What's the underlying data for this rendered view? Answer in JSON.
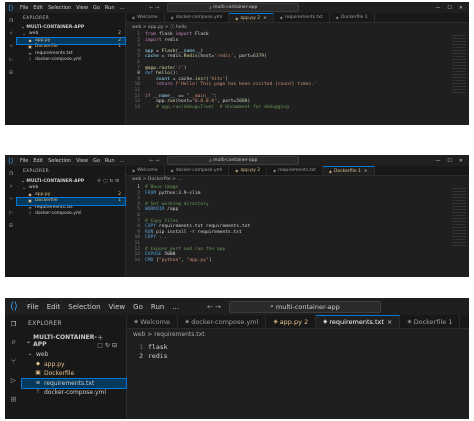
{
  "menu": [
    "File",
    "Edit",
    "Selection",
    "View",
    "Go",
    "Run",
    "..."
  ],
  "nav_arrows": "← →",
  "window_controls": [
    "—",
    "☐",
    "✕"
  ],
  "icons": {
    "activity": [
      "files-icon",
      "search-icon",
      "source-control-icon",
      "run-debug-icon",
      "extensions-icon"
    ]
  },
  "colors": {
    "accent": "#0078d4",
    "modified": "#e2c08d",
    "background": "#1e1e1e"
  },
  "panels": [
    {
      "command_center": "multi-container-app",
      "explorer_title": "EXPLORER",
      "project": "MULTI-CONTAINER-APP",
      "tree": [
        {
          "label": "web",
          "type": "folder",
          "badge": "2"
        },
        {
          "label": "app.py",
          "type": "python",
          "badge": "2",
          "selected": true,
          "modified": true
        },
        {
          "label": "Dockerfile",
          "type": "docker",
          "badge": "1",
          "modified": true
        },
        {
          "label": "requirements.txt",
          "type": "text",
          "badge": ""
        },
        {
          "label": "docker-compose.yml",
          "type": "yaml",
          "badge": ""
        }
      ],
      "tabs": [
        {
          "label": "Welcome",
          "active": false
        },
        {
          "label": "docker-compose.yml",
          "active": false
        },
        {
          "label": "app.py 2",
          "active": true,
          "modified": true
        },
        {
          "label": "requirements.txt",
          "active": false
        },
        {
          "label": "Dockerfile 1",
          "active": false
        }
      ],
      "breadcrumb": "web > app.py > ⓘ hello",
      "code": [
        [
          [
            "k",
            "from "
          ],
          [
            "p",
            "flask "
          ],
          [
            "k",
            "import "
          ],
          [
            "p",
            "Flask"
          ]
        ],
        [
          [
            "k",
            "import "
          ],
          [
            "p",
            "redis"
          ]
        ],
        [],
        [
          [
            "v",
            "app "
          ],
          [
            "p",
            "= "
          ],
          [
            "f",
            "Flask"
          ],
          [
            "p",
            "("
          ],
          [
            "v",
            "__name__"
          ],
          [
            "p",
            ")"
          ]
        ],
        [
          [
            "v",
            "cache "
          ],
          [
            "p",
            "= redis."
          ],
          [
            "f",
            "Redis"
          ],
          [
            "p",
            "(host="
          ],
          [
            "s",
            "'redis'"
          ],
          [
            "p",
            ", port="
          ],
          [
            "n",
            "6379"
          ],
          [
            "p",
            ")"
          ]
        ],
        [],
        [
          [
            "f",
            "@app.route"
          ],
          [
            "p",
            "("
          ],
          [
            "s",
            "'/'"
          ],
          [
            "p",
            ")"
          ]
        ],
        [
          [
            "d",
            "def "
          ],
          [
            "f",
            "hello"
          ],
          [
            "p",
            "():"
          ]
        ],
        [
          [
            "p",
            "    "
          ],
          [
            "v",
            "count "
          ],
          [
            "p",
            "= cache."
          ],
          [
            "f",
            "incr"
          ],
          [
            "p",
            "("
          ],
          [
            "s",
            "'hits'"
          ],
          [
            "p",
            ")"
          ]
        ],
        [
          [
            "p",
            "    "
          ],
          [
            "k",
            "return "
          ],
          [
            "s",
            "f'Hello! This page has been visited {count} times.'"
          ]
        ],
        [],
        [
          [
            "k",
            "if "
          ],
          [
            "v",
            "__name__ "
          ],
          [
            "p",
            "== "
          ],
          [
            "s",
            "\"__main__\""
          ],
          [
            "p",
            ":"
          ]
        ],
        [
          [
            "p",
            "    app."
          ],
          [
            "f",
            "run"
          ],
          [
            "p",
            "(host="
          ],
          [
            "s",
            "\"0.0.0.0\""
          ],
          [
            "p",
            ", port="
          ],
          [
            "n",
            "5000"
          ],
          [
            "p",
            ")"
          ]
        ],
        [
          [
            "p",
            "    "
          ],
          [
            "c",
            "# app.run(debug=True)  # Uncomment for debugging"
          ]
        ]
      ],
      "current_line": 8
    },
    {
      "command_center": "multi-container-app",
      "explorer_title": "EXPLORER",
      "project": "MULTI-CONTAINER-APP",
      "tree": [
        {
          "label": "web",
          "type": "folder",
          "badge": ""
        },
        {
          "label": "app.py",
          "type": "python",
          "badge": "2",
          "modified": true
        },
        {
          "label": "Dockerfile",
          "type": "docker",
          "badge": "1",
          "selected": true,
          "modified": true
        },
        {
          "label": "requirements.txt",
          "type": "text",
          "badge": ""
        },
        {
          "label": "docker-compose.yml",
          "type": "yaml",
          "badge": ""
        }
      ],
      "tabs": [
        {
          "label": "Welcome",
          "active": false
        },
        {
          "label": "docker-compose.yml",
          "active": false
        },
        {
          "label": "app.py 2",
          "active": false,
          "modified": true
        },
        {
          "label": "requirements.txt",
          "active": false
        },
        {
          "label": "Dockerfile 1",
          "active": true,
          "modified": true
        }
      ],
      "breadcrumb": "web > Dockerfile > ...",
      "code": [
        [
          [
            "c",
            "# Base image"
          ]
        ],
        [
          [
            "d",
            "FROM "
          ],
          [
            "p",
            "python:3.9-slim"
          ]
        ],
        [],
        [
          [
            "c",
            "# Set working directory"
          ]
        ],
        [
          [
            "d",
            "WORKDIR "
          ],
          [
            "p",
            "/app"
          ]
        ],
        [],
        [
          [
            "c",
            "# Copy files"
          ]
        ],
        [
          [
            "d",
            "COPY "
          ],
          [
            "p",
            "requirements.txt requirements.txt"
          ]
        ],
        [
          [
            "d",
            "RUN "
          ],
          [
            "p",
            "pip install -r requirements.txt"
          ]
        ],
        [
          [
            "d",
            "COPY "
          ],
          [
            "p",
            ". ."
          ]
        ],
        [],
        [
          [
            "c",
            "# Expose port and run the app"
          ]
        ],
        [
          [
            "d",
            "EXPOSE "
          ],
          [
            "p",
            "5000"
          ]
        ],
        [
          [
            "d",
            "CMD "
          ],
          [
            "p",
            "["
          ],
          [
            "s",
            "\"python\""
          ],
          [
            "p",
            ", "
          ],
          [
            "s",
            "\"app.py\""
          ],
          [
            "p",
            "]"
          ]
        ]
      ],
      "current_line": 1
    },
    {
      "command_center": "multi-container-app",
      "explorer_title": "EXPLORER",
      "project": "MULTI-CONTAINER-APP",
      "tree": [
        {
          "label": "web",
          "type": "folder",
          "badge": ""
        },
        {
          "label": "app.py",
          "type": "python",
          "badge": "",
          "modified": true
        },
        {
          "label": "Dockerfile",
          "type": "docker",
          "badge": "",
          "modified": true
        },
        {
          "label": "requirements.txt",
          "type": "text",
          "badge": "",
          "selected": true
        },
        {
          "label": "docker-compose.yml",
          "type": "yaml",
          "badge": ""
        }
      ],
      "tabs": [
        {
          "label": "Welcome",
          "active": false
        },
        {
          "label": "docker-compose.yml",
          "active": false
        },
        {
          "label": "app.py 2",
          "active": false,
          "modified": true
        },
        {
          "label": "requirements.txt",
          "active": true
        },
        {
          "label": "Dockerfile 1",
          "active": false
        }
      ],
      "breadcrumb": "web > requirements.txt",
      "code": [
        [
          [
            "p",
            "flask"
          ]
        ],
        [
          [
            "p",
            "redis"
          ]
        ]
      ],
      "current_line": 2
    }
  ]
}
